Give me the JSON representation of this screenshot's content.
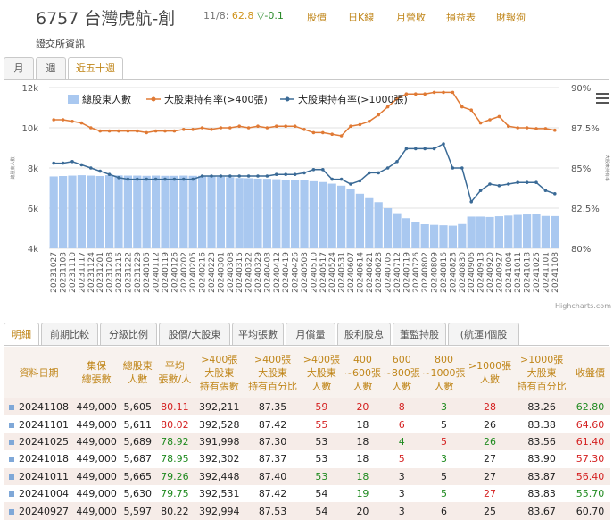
{
  "header": {
    "code_name": "6757 台灣虎航-創",
    "date": "11/8:",
    "price": "62.8",
    "change": "▽-0.1",
    "nav": [
      "股價",
      "日K線",
      "月營收",
      "損益表",
      "財報狗"
    ],
    "subtitle": "證交所資訊"
  },
  "period_tabs": [
    "月",
    "週",
    "近五十週"
  ],
  "chart_data": {
    "type": "bar",
    "legend": [
      "總股東人數",
      "大股東持有率(>400張)",
      "大股東持有率(>1000張)"
    ],
    "y_left_ticks": [
      "12k",
      "10k",
      "8k",
      "6k",
      "4k"
    ],
    "y_left_range": [
      4000,
      12000
    ],
    "y_right_ticks": [
      "90%",
      "87.5%",
      "85%",
      "82.5%",
      "80%"
    ],
    "y_right_range": [
      80,
      90
    ],
    "y_left_label": "總股東人數",
    "y_right_label": "大股東持有率",
    "x_labels": [
      "20231027",
      "20231103",
      "20231110",
      "20231117",
      "20231124",
      "20231201",
      "20231208",
      "20231215",
      "20231222",
      "20231229",
      "20240105",
      "20240112",
      "20240119",
      "20240126",
      "20240202",
      "20240205",
      "20240216",
      "20240223",
      "20240301",
      "20240308",
      "20240315",
      "20240322",
      "20240329",
      "20240403",
      "20240412",
      "20240419",
      "20240426",
      "20240503",
      "20240510",
      "20240517",
      "20240524",
      "20240531",
      "20240607",
      "20240614",
      "20240621",
      "20240628",
      "20240705",
      "20240712",
      "20240719",
      "20240726",
      "20240802",
      "20240809",
      "20240816",
      "20240823",
      "20240830",
      "20240906",
      "20240913",
      "20240920",
      "20240927",
      "20241004",
      "20241011",
      "20241018",
      "20241025",
      "20241101",
      "20241108"
    ],
    "holders": [
      7580,
      7600,
      7620,
      7640,
      7620,
      7600,
      7640,
      7630,
      7620,
      7620,
      7610,
      7620,
      7610,
      7610,
      7620,
      7610,
      7610,
      7600,
      7560,
      7540,
      7500,
      7490,
      7470,
      7460,
      7440,
      7420,
      7400,
      7380,
      7340,
      7300,
      7220,
      7120,
      6950,
      6720,
      6500,
      6300,
      6000,
      5750,
      5500,
      5300,
      5200,
      5170,
      5150,
      5130,
      5210,
      5580,
      5580,
      5560,
      5597,
      5630,
      5665,
      5687,
      5689,
      5611,
      5605
    ],
    "ratio_400": [
      88.0,
      88.0,
      87.9,
      87.8,
      87.5,
      87.3,
      87.3,
      87.3,
      87.3,
      87.3,
      87.2,
      87.3,
      87.3,
      87.3,
      87.4,
      87.4,
      87.5,
      87.4,
      87.5,
      87.5,
      87.6,
      87.5,
      87.6,
      87.5,
      87.6,
      87.6,
      87.6,
      87.4,
      87.2,
      87.2,
      87.1,
      87.0,
      87.6,
      87.7,
      87.9,
      88.3,
      88.8,
      89.3,
      89.6,
      89.6,
      89.6,
      89.7,
      89.7,
      89.7,
      88.8,
      88.6,
      87.8,
      88.0,
      88.2,
      87.6,
      87.5,
      87.5,
      87.45,
      87.45,
      87.35
    ],
    "ratio_1000": [
      85.3,
      85.3,
      85.4,
      85.2,
      85.0,
      84.8,
      84.6,
      84.4,
      84.3,
      84.3,
      84.3,
      84.3,
      84.3,
      84.3,
      84.3,
      84.3,
      84.5,
      84.5,
      84.5,
      84.5,
      84.5,
      84.5,
      84.5,
      84.5,
      84.6,
      84.6,
      84.6,
      84.7,
      84.9,
      84.9,
      84.3,
      84.3,
      84.0,
      84.2,
      84.7,
      84.7,
      85.0,
      85.4,
      86.2,
      86.2,
      86.2,
      86.2,
      86.5,
      85.0,
      85.0,
      82.9,
      83.6,
      84.0,
      83.9,
      84.0,
      84.1,
      84.1,
      84.1,
      83.6,
      83.4
    ],
    "credits": "Highcharts.com"
  },
  "colors": {
    "accent": "#c0861a",
    "bar": "#a9c8f0",
    "line_400": "#e07a35",
    "line_1000": "#3a6a96"
  },
  "data_tabs": [
    "明細",
    "前期比較",
    "分級比例",
    "股價/大股東",
    "平均張數",
    "月償量",
    "股利股息",
    "董監持股",
    "(航運)個股"
  ],
  "table": {
    "headers": [
      [
        "資料日期",
        ""
      ],
      [
        "集保",
        "總張數"
      ],
      [
        "總股東",
        "人數"
      ],
      [
        "平均",
        "張數/人"
      ],
      [
        ">400張",
        "大股東",
        "持有張數"
      ],
      [
        ">400張",
        "大股東",
        "持有百分比"
      ],
      [
        ">400張",
        "大股東",
        "人數"
      ],
      [
        "400",
        "~600張",
        "人數"
      ],
      [
        "600",
        "~800張",
        "人數"
      ],
      [
        "800",
        "~1000張",
        "人數"
      ],
      [
        ">1000張",
        "人數"
      ],
      [
        ">1000張",
        "大股東",
        "持有百分比"
      ],
      [
        "收盤價"
      ]
    ],
    "rows": [
      [
        "20241108",
        "449,000",
        "5,605",
        "80.11",
        "392,211",
        "87.35",
        "59",
        "20",
        "8",
        "3",
        "28",
        "83.26",
        "62.80"
      ],
      [
        "20241101",
        "449,000",
        "5,611",
        "80.02",
        "392,528",
        "87.42",
        "55",
        "18",
        "6",
        "5",
        "26",
        "83.38",
        "64.60"
      ],
      [
        "20241025",
        "449,000",
        "5,689",
        "78.92",
        "391,998",
        "87.30",
        "53",
        "18",
        "4",
        "5",
        "26",
        "83.56",
        "61.40"
      ],
      [
        "20241018",
        "449,000",
        "5,687",
        "78.95",
        "392,302",
        "87.37",
        "53",
        "18",
        "5",
        "3",
        "27",
        "83.90",
        "57.30"
      ],
      [
        "20241011",
        "449,000",
        "5,665",
        "79.26",
        "392,448",
        "87.40",
        "53",
        "18",
        "3",
        "5",
        "27",
        "83.87",
        "56.40"
      ],
      [
        "20241004",
        "449,000",
        "5,630",
        "79.75",
        "392,531",
        "87.42",
        "54",
        "19",
        "3",
        "5",
        "27",
        "83.83",
        "55.70"
      ],
      [
        "20240927",
        "449,000",
        "5,597",
        "80.22",
        "392,994",
        "87.53",
        "54",
        "20",
        "3",
        "6",
        "25",
        "83.67",
        "60.70"
      ]
    ]
  }
}
